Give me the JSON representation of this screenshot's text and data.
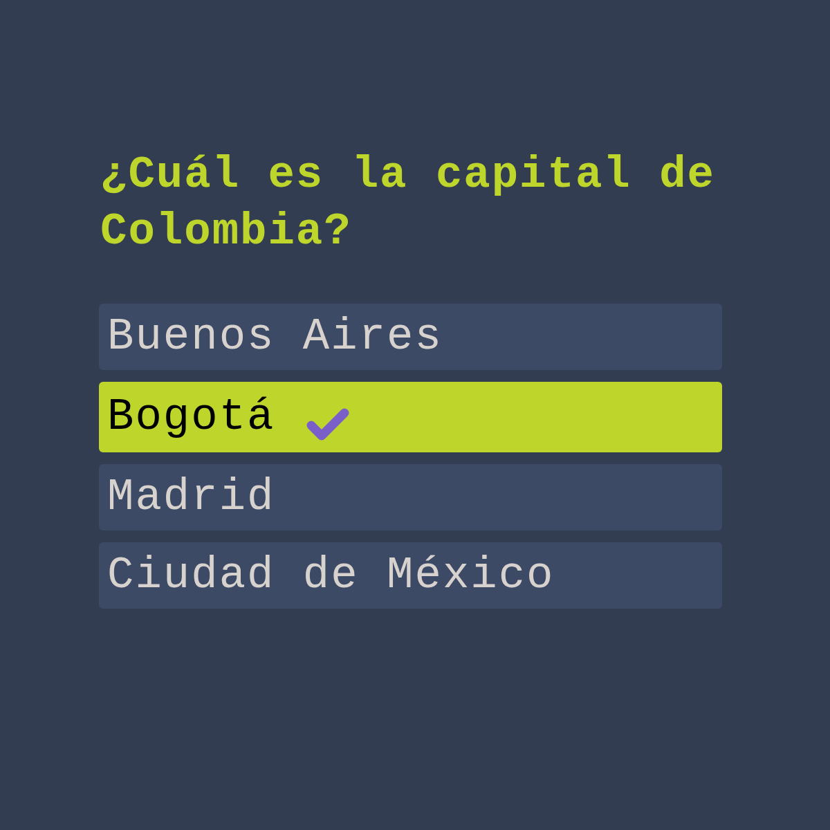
{
  "question": "¿Cuál es la capital de Colombia?",
  "options": [
    {
      "label": "Buenos Aires",
      "selected": false
    },
    {
      "label": "Bogotá",
      "selected": true
    },
    {
      "label": "Madrid",
      "selected": false
    },
    {
      "label": "Ciudad de México",
      "selected": false
    }
  ]
}
